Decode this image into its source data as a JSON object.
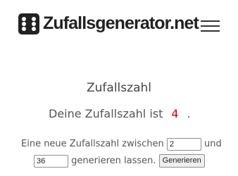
{
  "header": {
    "logo_icon": "dice-icon",
    "logo_text": "Zufallsgenerator.net",
    "menu_icon": "hamburger-menu-icon"
  },
  "main": {
    "heading": "Zufallszahl",
    "result_prefix": "Deine Zufallszahl ist",
    "result_value": "4",
    "result_suffix": ".",
    "form_text_1": "Eine neue Zufallszahl zwischen",
    "min_value": "2",
    "form_text_2": "und",
    "max_value": "36",
    "form_text_3": "generieren lassen.",
    "button_label": "Generieren"
  },
  "colors": {
    "result_value": "#cc0000",
    "logo": "#222222"
  }
}
